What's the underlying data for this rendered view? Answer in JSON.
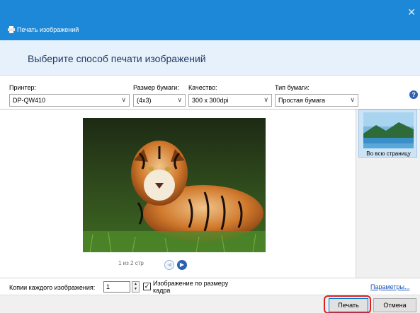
{
  "window": {
    "title": "Печать изображений",
    "close_glyph": "✕",
    "app_icon": "printer-icon"
  },
  "banner": {
    "heading": "Выберите способ печати изображений"
  },
  "settings": {
    "printer": {
      "label": "Принтер:",
      "value": "DP-QW410"
    },
    "paper_size": {
      "label": "Размер бумаги:",
      "value": "(4x3)"
    },
    "quality": {
      "label": "Качество:",
      "value": "300 x 300dpi"
    },
    "paper_type": {
      "label": "Тип бумаги:",
      "value": "Простая бумага"
    },
    "dropdown_arrow": "∨",
    "help_icon": "?"
  },
  "preview": {
    "image": "tiger-photo",
    "page_info": "1 из 2 стр",
    "prev_glyph": "◀",
    "next_glyph": "▶"
  },
  "layouts": {
    "selected": "Во всю страницу",
    "thumbnail": "landscape-thumbnail"
  },
  "options": {
    "copies_label": "Копии каждого изображения:",
    "copies_value": "1",
    "fit_checked": true,
    "fit_label": "Изображение по размеру кадра",
    "check_glyph": "✓",
    "params_link": "Параметры..."
  },
  "buttons": {
    "print": "Печать",
    "cancel": "Отмена"
  },
  "colors": {
    "titlebar": "#1e88d8",
    "banner": "#e7f1fb",
    "accent": "#0078d7",
    "highlight": "#e02020"
  }
}
